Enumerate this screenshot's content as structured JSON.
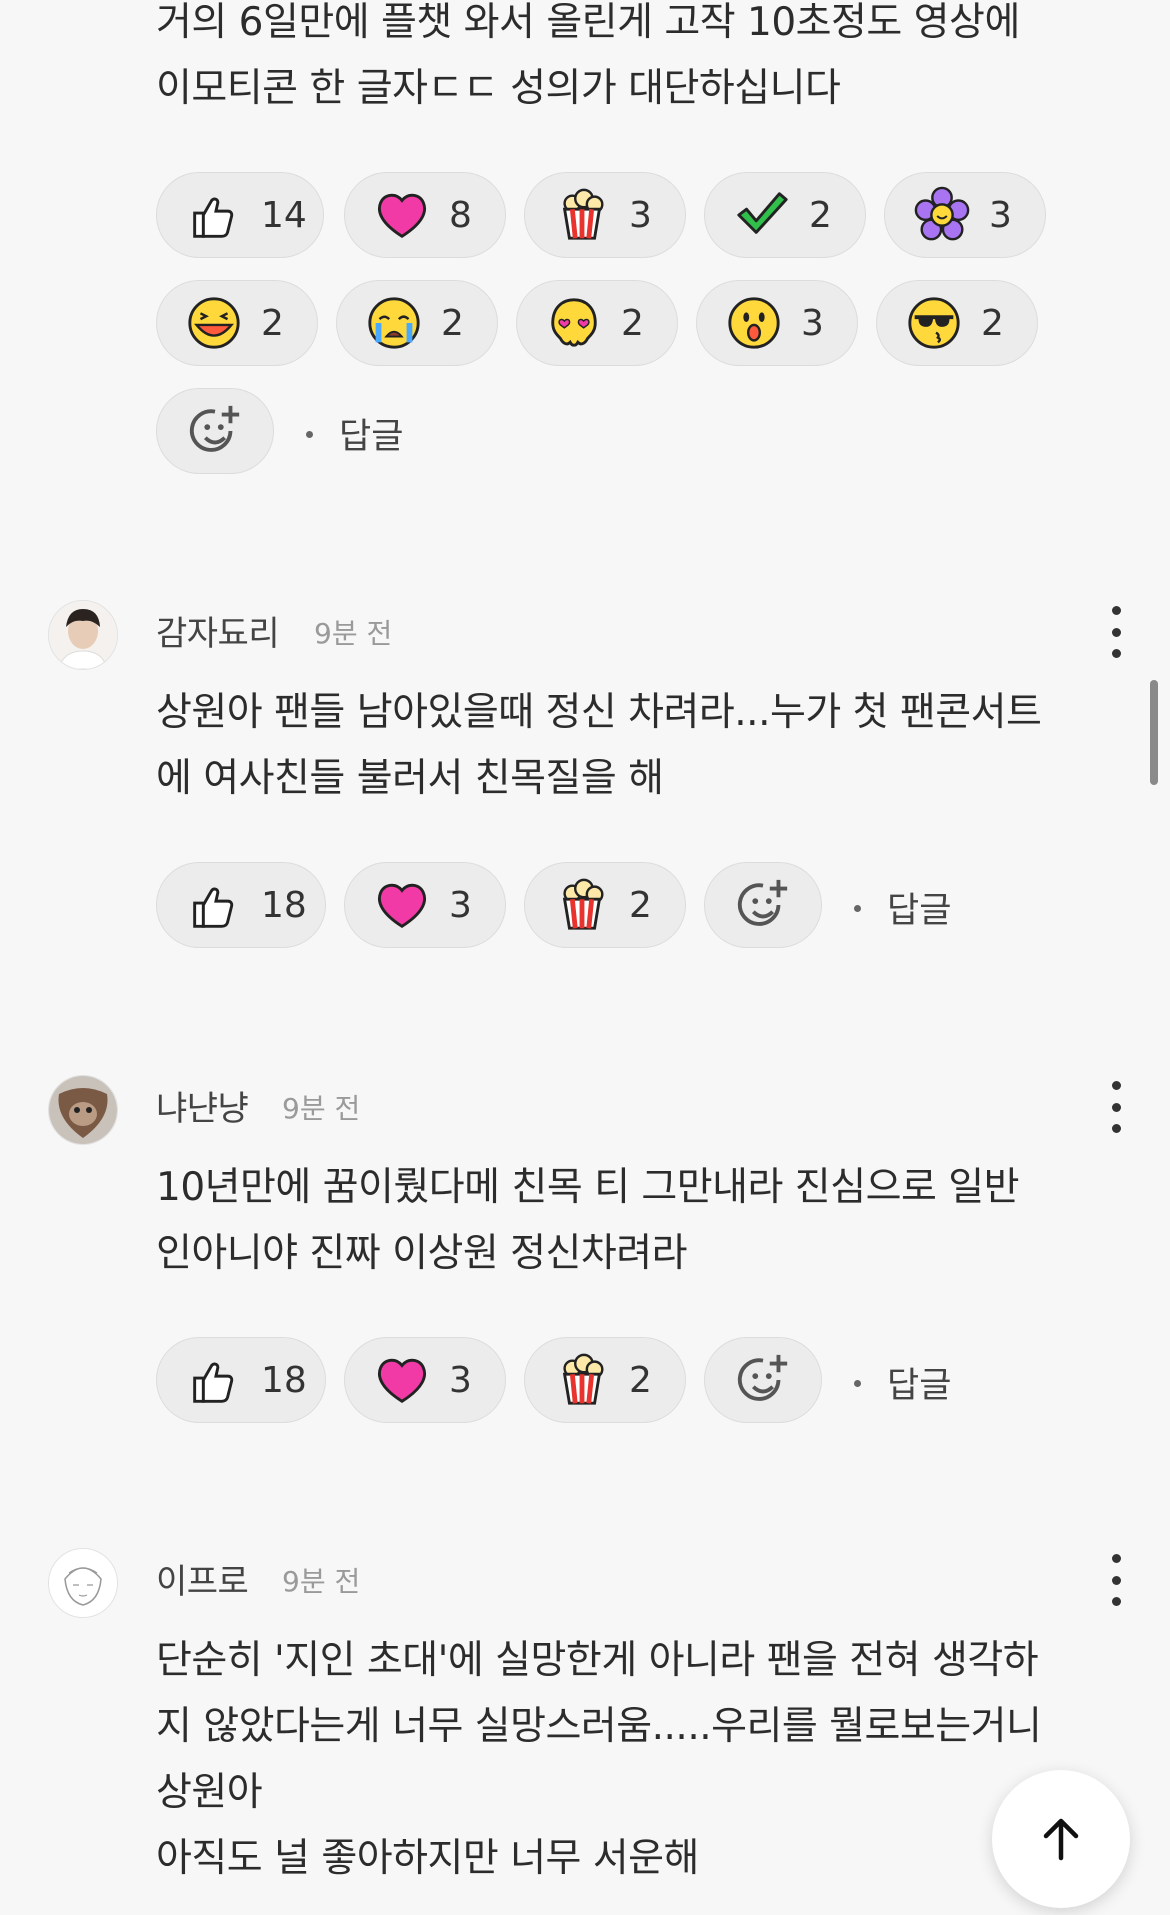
{
  "comments": [
    {
      "text": "거의 6일만에 플챗 와서 올린게 고작 10초정도 영상에\n이모티콘 한 글자ㄷㄷ 성의가 대단하십니다",
      "reactions": [
        {
          "icon": "thumbs-up-icon",
          "count": "14"
        },
        {
          "icon": "heart-icon",
          "count": "8"
        },
        {
          "icon": "popcorn-icon",
          "count": "3"
        },
        {
          "icon": "checkmark-icon",
          "count": "2"
        },
        {
          "icon": "flower-icon",
          "count": "3"
        },
        {
          "icon": "laughing-face-icon",
          "count": "2"
        },
        {
          "icon": "crying-face-icon",
          "count": "2"
        },
        {
          "icon": "heart-eyes-face-icon",
          "count": "2"
        },
        {
          "icon": "surprised-face-icon",
          "count": "3"
        },
        {
          "icon": "sunglasses-face-icon",
          "count": "2"
        }
      ],
      "reply_label": "답글"
    },
    {
      "author": "감자됴리",
      "time": "9분 전",
      "text": "상원아 팬들 남아있을때 정신 차려라...누가 첫 팬콘서트\n에 여사친들 불러서 친목질을 해",
      "reactions": [
        {
          "icon": "thumbs-up-icon",
          "count": "18"
        },
        {
          "icon": "heart-icon",
          "count": "3"
        },
        {
          "icon": "popcorn-icon",
          "count": "2"
        }
      ],
      "reply_label": "답글"
    },
    {
      "author": "냐냔냥",
      "time": "9분 전",
      "text": "10년만에 꿈이뤘다메 친목 티 그만내라 진심으로 일반\n인아니야 진짜 이상원 정신차려라",
      "reactions": [
        {
          "icon": "thumbs-up-icon",
          "count": "18"
        },
        {
          "icon": "heart-icon",
          "count": "3"
        },
        {
          "icon": "popcorn-icon",
          "count": "2"
        }
      ],
      "reply_label": "답글"
    },
    {
      "author": "이프로",
      "time": "9분 전",
      "text": "단순히 '지인 초대'에 실망한게 아니라 팬을 전혀 생각하\n지 않았다는게 너무 실망스러움.....우리를 뭘로보는거니\n상원아\n아직도 널 좋아하지만 너무 서운해"
    }
  ],
  "colors": {
    "background": "#f7f7f7",
    "pill": "#ececec",
    "text": "#2c2c2c",
    "muted": "#9a9a9a"
  }
}
